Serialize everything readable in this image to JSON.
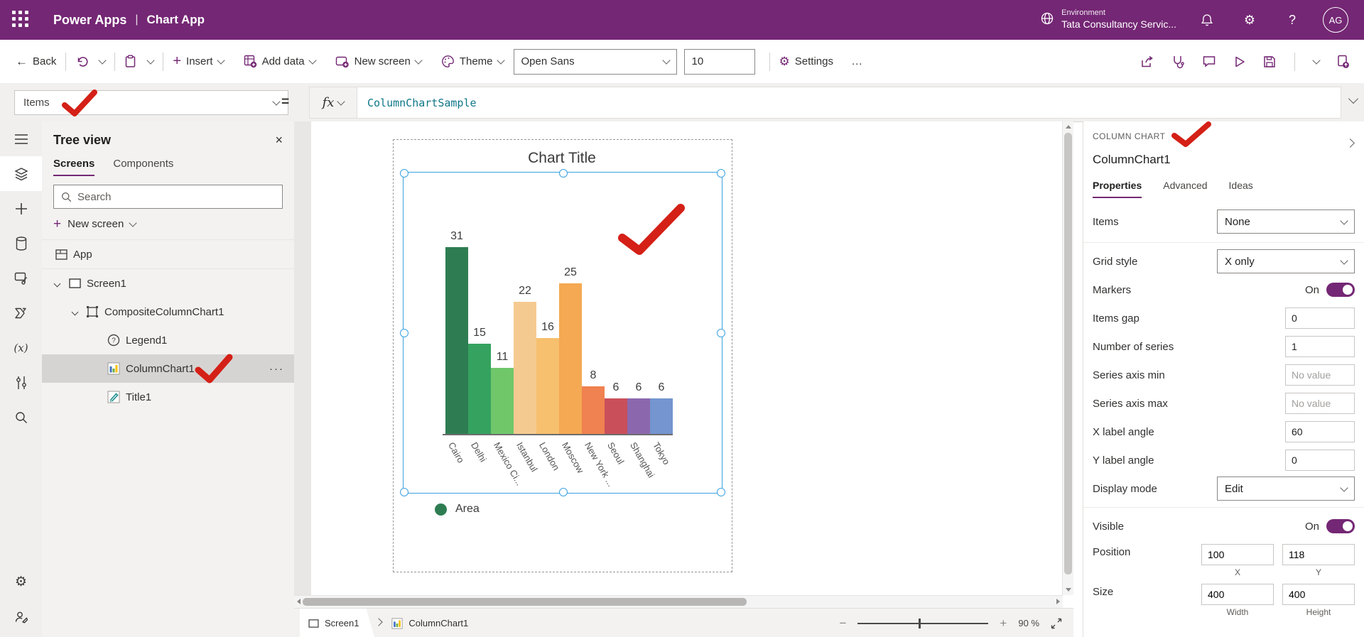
{
  "header": {
    "brand": "Power Apps",
    "separator": "|",
    "app_name": "Chart App",
    "environment_label": "Environment",
    "environment_name": "Tata Consultancy Servic...",
    "help": "?",
    "avatar_initials": "AG"
  },
  "toolbar": {
    "back": "Back",
    "insert": "Insert",
    "add_data": "Add data",
    "new_screen": "New screen",
    "theme": "Theme",
    "font_family": "Open Sans",
    "font_size": "10",
    "settings": "Settings",
    "more": "..."
  },
  "formula_bar": {
    "property": "Items",
    "equals": "=",
    "fx": "fx",
    "formula": "ColumnChartSample"
  },
  "rail_icons": [
    "hamburger",
    "tree-view",
    "insert-plus",
    "data",
    "media",
    "power-automate",
    "variables",
    "controls",
    "search",
    "settings",
    "advanced-tools"
  ],
  "tree": {
    "title": "Tree view",
    "close": "×",
    "tabs": [
      "Screens",
      "Components"
    ],
    "active_tab": "Screens",
    "search_placeholder": "Search",
    "new_screen": "New screen",
    "items": {
      "app": {
        "label": "App"
      },
      "screen1": {
        "label": "Screen1"
      },
      "composite": {
        "label": "CompositeColumnChart1"
      },
      "legend1": {
        "label": "Legend1"
      },
      "columnchart1": {
        "label": "ColumnChart1",
        "more": "···",
        "selected": true
      },
      "title1": {
        "label": "Title1"
      }
    }
  },
  "chart_data": {
    "type": "bar",
    "title": "Chart Title",
    "categories": [
      "Cairo",
      "Delhi",
      "Mexico Ci...",
      "Istanbul",
      "London",
      "Moscow",
      "New York ...",
      "Seoul",
      "Shanghai",
      "Tokyo"
    ],
    "values": [
      31,
      15,
      11,
      22,
      16,
      25,
      8,
      6,
      6,
      6
    ],
    "colors": [
      "#2e7d52",
      "#35a25f",
      "#6fc76a",
      "#f5ca90",
      "#f6c06e",
      "#f4a952",
      "#f08150",
      "#c94f5a",
      "#8b68ad",
      "#7495cf"
    ],
    "value_labels_shown": true,
    "x_label_angle": 60,
    "grid": "X only",
    "legend": [
      {
        "label": "Area",
        "color": "#2e7d52"
      }
    ],
    "legend_position": "bottom-left"
  },
  "panel": {
    "control_type": "COLUMN CHART",
    "control_name": "ColumnChart1",
    "tabs": [
      "Properties",
      "Advanced",
      "Ideas"
    ],
    "active_tab": "Properties",
    "fields": {
      "items": {
        "label": "Items",
        "value": "None"
      },
      "grid_style": {
        "label": "Grid style",
        "value": "X only"
      },
      "markers": {
        "label": "Markers",
        "value": "On"
      },
      "items_gap": {
        "label": "Items gap",
        "value": "0"
      },
      "number_of_series": {
        "label": "Number of series",
        "value": "1"
      },
      "series_axis_min": {
        "label": "Series axis min",
        "placeholder": "No value"
      },
      "series_axis_max": {
        "label": "Series axis max",
        "placeholder": "No value"
      },
      "x_label_angle": {
        "label": "X label angle",
        "value": "60"
      },
      "y_label_angle": {
        "label": "Y label angle",
        "value": "0"
      },
      "display_mode": {
        "label": "Display mode",
        "value": "Edit"
      },
      "visible": {
        "label": "Visible",
        "value": "On"
      },
      "position": {
        "label": "Position",
        "x": "100",
        "y": "118",
        "xlabel": "X",
        "ylabel": "Y"
      },
      "size": {
        "label": "Size",
        "w": "400",
        "h": "400",
        "wlabel": "Width",
        "hlabel": "Height"
      }
    }
  },
  "status_bar": {
    "screen": "Screen1",
    "control": "ColumnChart1",
    "zoom_value": "90",
    "zoom_unit": "%"
  },
  "annotations": {
    "checkmark_color": "#d42017",
    "checkmarks": [
      "formula-property",
      "tree-columnchart1",
      "canvas-chart",
      "panel-header"
    ]
  }
}
